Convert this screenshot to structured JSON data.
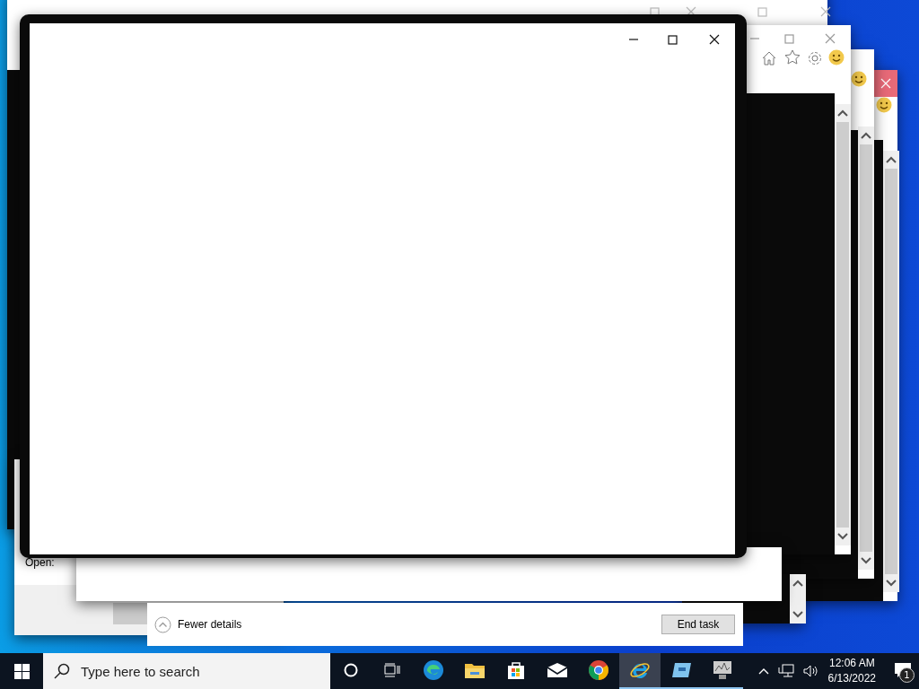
{
  "run_dialog": {
    "label": "Open:"
  },
  "task_manager": {
    "details_toggle": "Fewer details",
    "end_button": "End task"
  },
  "taskbar": {
    "search": {
      "placeholder": "Type here to search"
    },
    "apps": [
      {
        "kind": "cortana",
        "selected": false,
        "running": false
      },
      {
        "kind": "taskview",
        "selected": false,
        "running": false
      },
      {
        "kind": "edge",
        "selected": false,
        "running": false
      },
      {
        "kind": "folder",
        "selected": false,
        "running": false
      },
      {
        "kind": "store",
        "selected": false,
        "running": false
      },
      {
        "kind": "mail",
        "selected": false,
        "running": false
      },
      {
        "kind": "chrome",
        "selected": false,
        "running": false
      },
      {
        "kind": "ie",
        "selected": true,
        "running": true
      },
      {
        "kind": "remote",
        "selected": false,
        "running": true
      },
      {
        "kind": "monitor",
        "selected": false,
        "running": true
      }
    ],
    "clock": {
      "time": "12:06 AM",
      "date": "6/13/2022"
    },
    "notifications": {
      "badge": "1"
    }
  }
}
